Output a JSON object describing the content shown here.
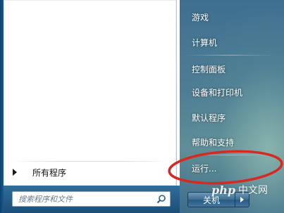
{
  "left_pane": {
    "all_programs_label": "所有程序",
    "search": {
      "placeholder": "搜索程序和文件"
    }
  },
  "right_pane": {
    "items": [
      {
        "label": "游戏"
      },
      {
        "label": "计算机"
      },
      {
        "label": "控制面板"
      },
      {
        "label": "设备和打印机"
      },
      {
        "label": "默认程序"
      },
      {
        "label": "帮助和支持"
      },
      {
        "label": "运行..."
      }
    ],
    "shutdown_label": "关机"
  },
  "watermark": {
    "brand": "php",
    "text": "中文网"
  },
  "annotation": {
    "color": "#d9281f",
    "target": "运行..."
  }
}
